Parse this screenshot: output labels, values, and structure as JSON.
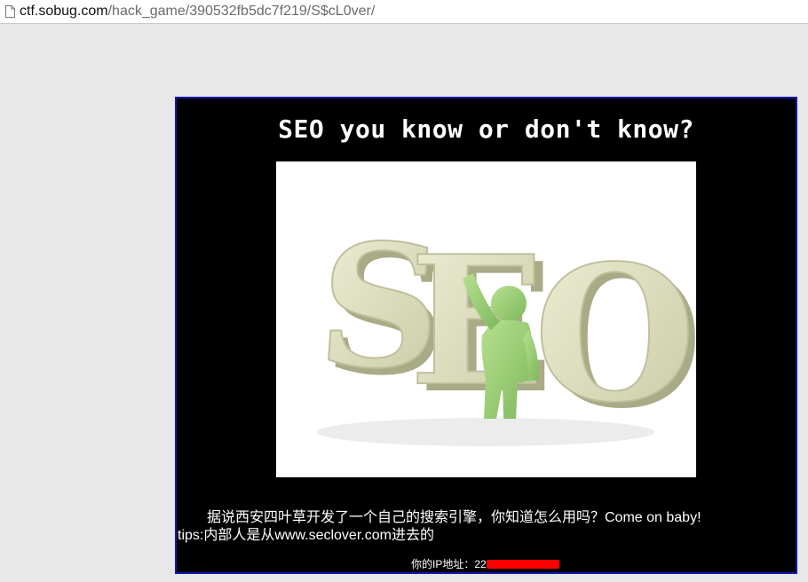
{
  "browser": {
    "url_host": "ctf.sobug.com",
    "url_path": "/hack_game/390532fb5dc7f219/S$cL0ver/"
  },
  "page": {
    "title": "SEO you know or don't know?",
    "image_text": "SEO",
    "description_line1": "据说西安四叶草开发了一个自己的搜索引擎，你知道怎么用吗？Come on baby!",
    "description_line2": "tips:内部人是从www.seclover.com进去的",
    "ip_label": "你的IP地址：22"
  },
  "colors": {
    "panel_background": "#000000",
    "panel_border": "#1818a8",
    "redaction": "#ff0000",
    "figure_green": "#9fce7a",
    "letter_cream": "#e3e4c4"
  }
}
